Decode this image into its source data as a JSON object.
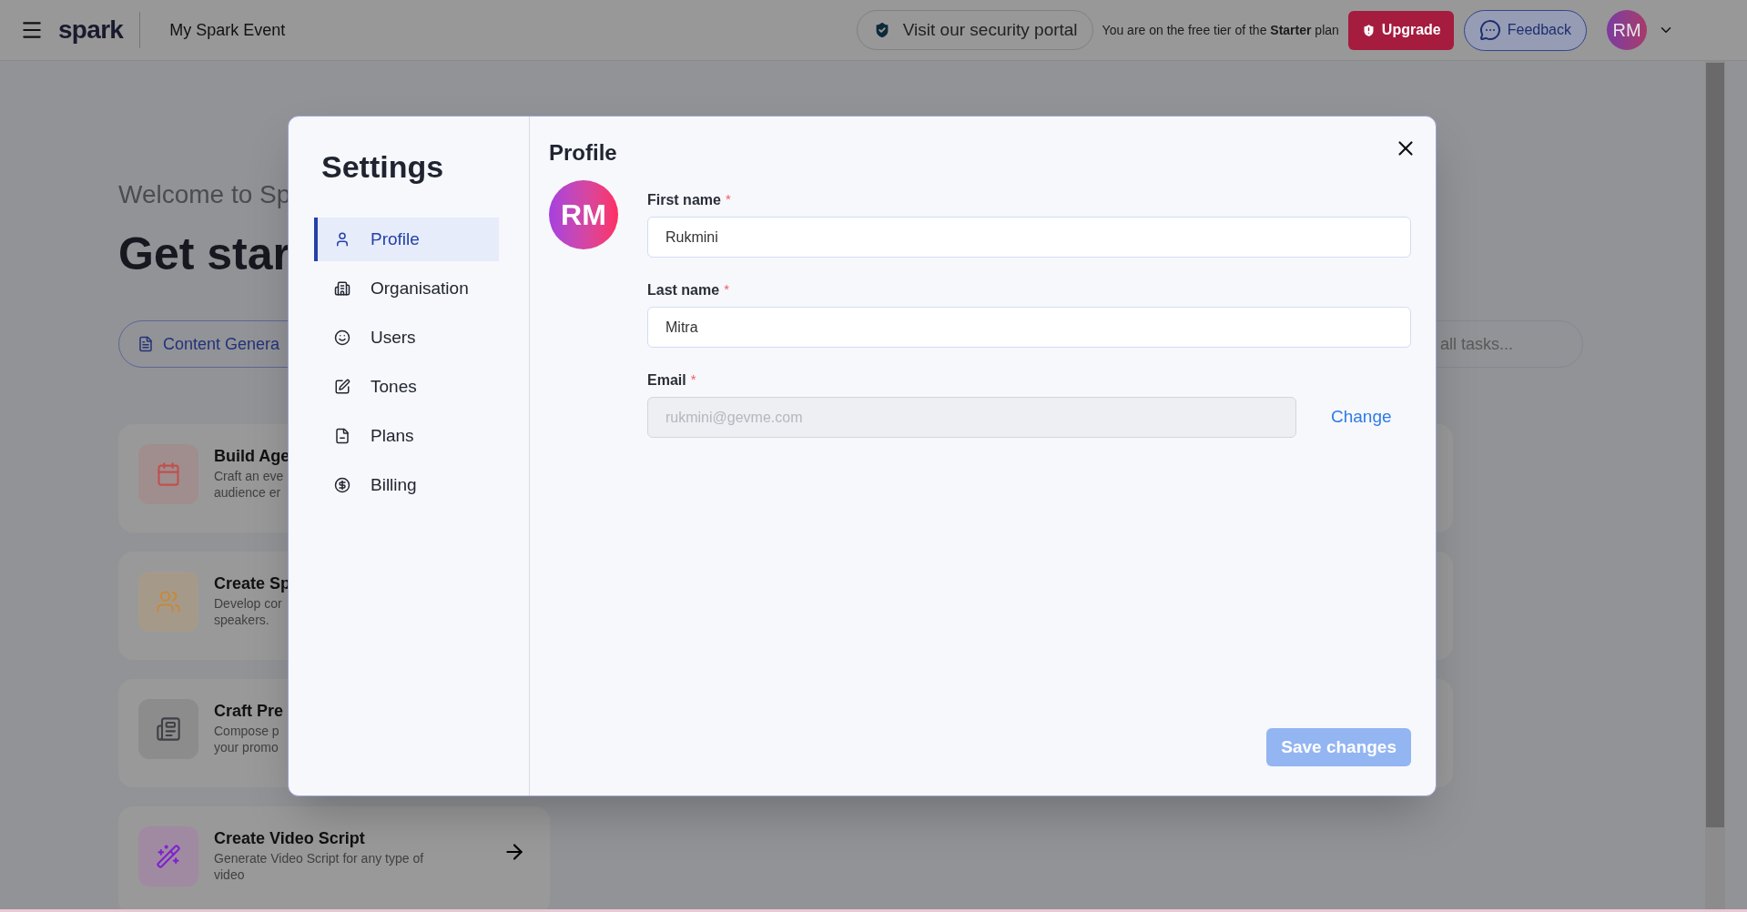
{
  "topbar": {
    "logo": "spark",
    "event_name": "My Spark Event",
    "security_link": "Visit our security portal",
    "plan_note": "You are on the free tier of the **Starter** plan",
    "upgrade": "Upgrade",
    "feedback": "Feedback",
    "avatar": "RM"
  },
  "background": {
    "welcome": "Welcome to Sp",
    "heading": "Get star",
    "filter_pill": "Content Genera",
    "search_pill": "all tasks...",
    "cards": [
      {
        "title": "Build Age",
        "lines": [
          "Craft an eve",
          "audience er"
        ],
        "color": "#c0504f"
      },
      {
        "title": "Create Sp",
        "lines": [
          "Develop cor",
          "speakers."
        ],
        "color": "#c58a3a"
      },
      {
        "title": "Craft Pre",
        "lines": [
          "Compose p",
          "your promo"
        ],
        "color": "#3f3f46"
      },
      {
        "title": "Create Video Script",
        "lines": [
          "Generate Video Script for any type of",
          "video"
        ],
        "color": "#7e22ce"
      }
    ]
  },
  "settings": {
    "title": "Settings",
    "nav": [
      {
        "label": "Profile",
        "selected": true
      },
      {
        "label": "Organisation",
        "selected": false
      },
      {
        "label": "Users",
        "selected": false
      },
      {
        "label": "Tones",
        "selected": false
      },
      {
        "label": "Plans",
        "selected": false
      },
      {
        "label": "Billing",
        "selected": false
      }
    ],
    "profile": {
      "title": "Profile",
      "avatar": "RM",
      "fields": [
        {
          "label": "First name",
          "required_mark": "*",
          "value": "Rukmini",
          "disabled": false
        },
        {
          "label": "Last name",
          "required_mark": "*",
          "value": "Mitra",
          "disabled": false
        },
        {
          "label": "Email",
          "required_mark": "*",
          "value": "rukmini@gevme.com",
          "disabled": true,
          "action": "Change"
        }
      ],
      "save": {
        "label": "Save changes",
        "disabled": true
      }
    }
  }
}
